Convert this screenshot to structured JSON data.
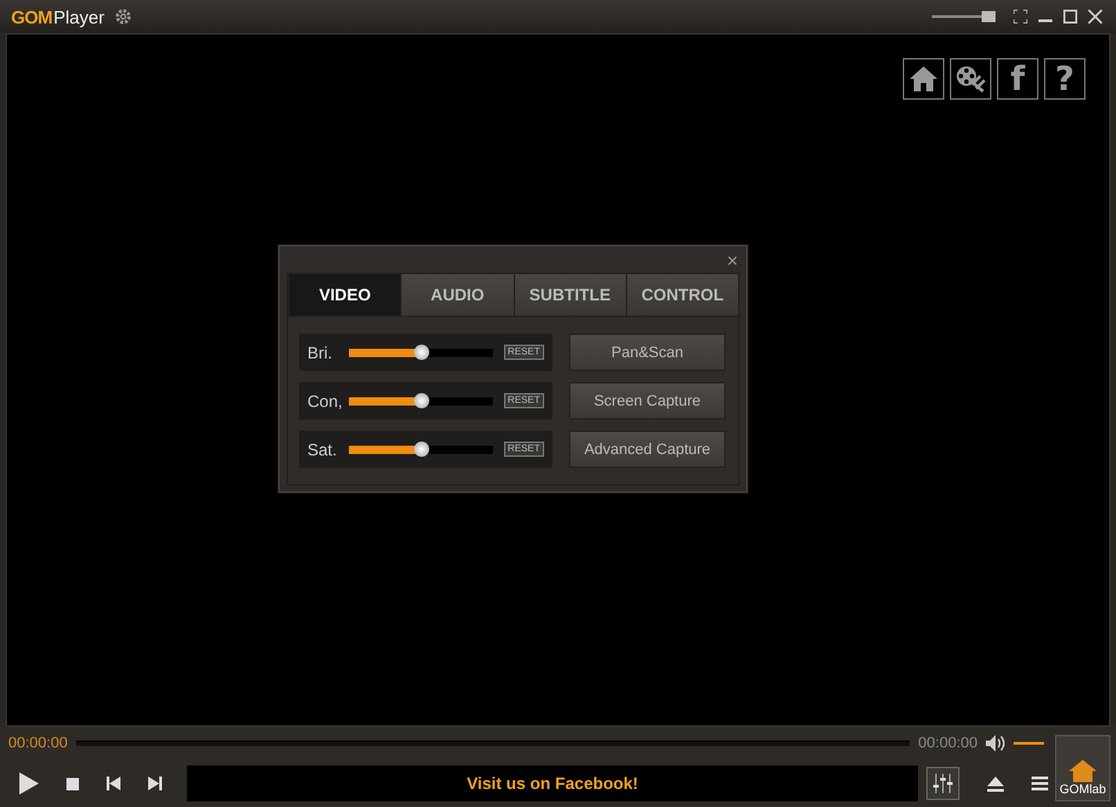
{
  "window": {
    "title_brand": "GOM",
    "title": "Player"
  },
  "title_bar": {
    "zoom": {
      "level": 0.9
    }
  },
  "corner_buttons": [
    {
      "kind": "home"
    },
    {
      "kind": "film"
    },
    {
      "kind": "facebook",
      "label": "f"
    },
    {
      "kind": "help",
      "label": "?"
    }
  ],
  "panel": {
    "close": "×",
    "tabs": [
      {
        "label": "VIDEO",
        "selected": true
      },
      {
        "label": "AUDIO",
        "selected": false
      },
      {
        "label": "SUBTITLE",
        "selected": false
      },
      {
        "label": "CONTROL",
        "selected": false
      }
    ],
    "sliders": [
      {
        "name": "Bri.",
        "level": 0.5,
        "reset": "RESET"
      },
      {
        "name": "Con,",
        "level": 0.5,
        "reset": "RESET"
      },
      {
        "name": "Sat.",
        "level": 0.5,
        "reset": "RESET"
      }
    ],
    "buttons": [
      "Pan&Scan",
      "Screen Capture",
      "Advanced Capture"
    ]
  },
  "seek": {
    "elapsed": "00:00:00",
    "total": "00:00:00"
  },
  "volume": {
    "level": 1
  },
  "ticker": "Visit us on Facebook!",
  "logo_button": "GOMlab"
}
